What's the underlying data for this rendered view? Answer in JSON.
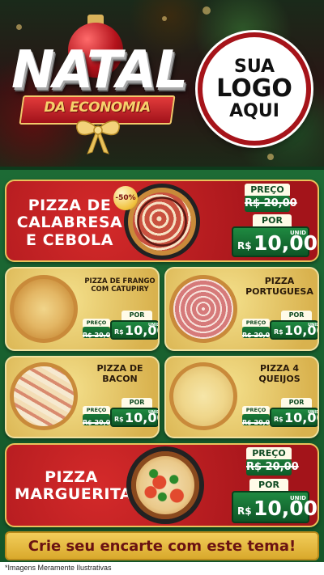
{
  "header": {
    "title": "NATAL",
    "subtitle": "DA ECONOMIA",
    "logo_lines": [
      "SUA",
      "LOGO",
      "AQUI"
    ]
  },
  "labels": {
    "preco": "PREÇO",
    "por": "POR",
    "unid": "UNID",
    "currency": "R$",
    "old_price": "20,00",
    "new_price": "10,00",
    "old_price_full": "R$ 20,00",
    "discount_badge": "-50%"
  },
  "products": {
    "calabresa": {
      "name_lines": [
        "PIZZA DE",
        "CALABRESA",
        "E CEBOLA"
      ]
    },
    "frango": {
      "name_lines": [
        "PIZZA DE FRANGO",
        "COM CATUPIRY"
      ]
    },
    "portuguesa": {
      "name_lines": [
        "PIZZA",
        "PORTUGUESA"
      ]
    },
    "bacon": {
      "name_lines": [
        "PIZZA DE",
        "BACON"
      ]
    },
    "queijos": {
      "name_lines": [
        "PIZZA 4",
        "QUEIJOS"
      ]
    },
    "marguerita": {
      "name_lines": [
        "PIZZA",
        "MARGUERITA"
      ]
    }
  },
  "cta": {
    "text": "Crie seu encarte com este tema!"
  },
  "footer": {
    "note": "*Imagens Meramente Ilustrativas"
  },
  "colors": {
    "red_card": "#a3141a",
    "gold_card": "#d9b24e",
    "green_bg": "#1d6b35",
    "price_green": "#1f8a41",
    "cta_gold": "#f2cd5a"
  }
}
